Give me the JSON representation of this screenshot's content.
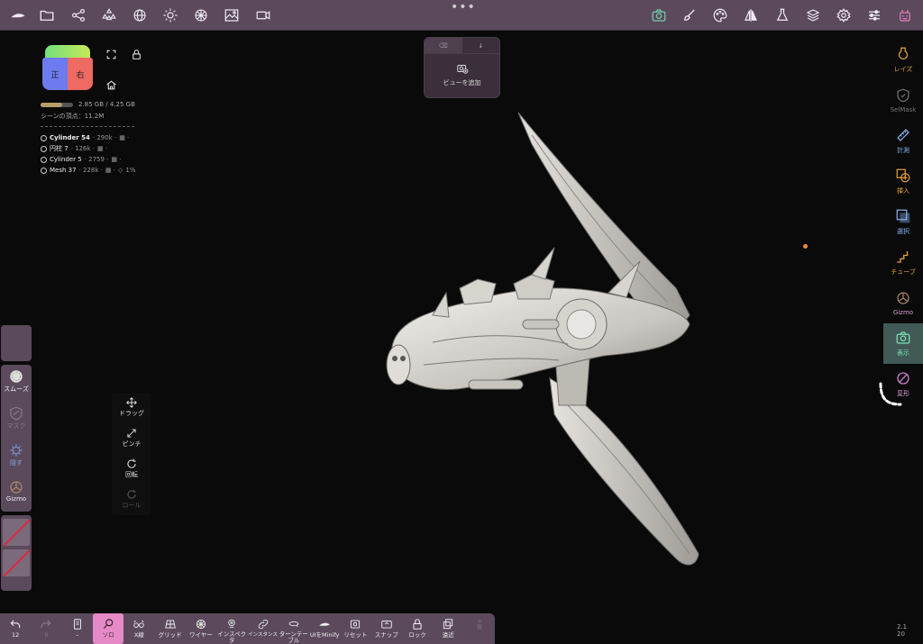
{
  "top_toolbar": {
    "left_icons": [
      "nomad-logo-icon",
      "folder-icon",
      "scene-graph-icon",
      "primitives-icon",
      "sphere-icon",
      "sun-icon",
      "material-icon",
      "image-icon",
      "video-camera-icon"
    ],
    "right_icons": [
      "camera-icon",
      "brush-icon",
      "palette-icon",
      "symmetry-icon",
      "flask-icon",
      "layers-icon",
      "settings-icon",
      "sliders-icon",
      "nomad-mascot-icon"
    ],
    "more": "•••"
  },
  "view_popover": {
    "tab_left": "⌫",
    "tab_right": "↓",
    "add_view_label": "ビューを追加"
  },
  "nav_cube": {
    "left_face": "正",
    "right_face": "右"
  },
  "memory": {
    "text": "2.85 GB / 4.25 GB",
    "fraction": 0.67
  },
  "scene_vertices": "シーンの頂点：11.2M",
  "objects": [
    {
      "name": "Cylinder 54",
      "count": "· 290k ·",
      "suffix": ""
    },
    {
      "name": "円柱 7",
      "count": "· 126k ·",
      "suffix": ""
    },
    {
      "name": "Cylinder 5",
      "count": "· 2759 ·",
      "suffix": ""
    },
    {
      "name": "Mesh 37",
      "count": "· 228k ·",
      "suffix": "1%"
    }
  ],
  "left_panel": {
    "tools": [
      {
        "label": "スムーズ",
        "icon": "smooth-icon"
      },
      {
        "label": "マスク",
        "icon": "mask-icon"
      },
      {
        "label": "隠す",
        "icon": "hide-icon"
      },
      {
        "label": "Gizmo",
        "icon": "gizmo-icon"
      }
    ]
  },
  "gestures": [
    {
      "label": "ドラッグ",
      "icon": "drag-icon"
    },
    {
      "label": "ピンチ",
      "icon": "pinch-icon"
    },
    {
      "label": "回転",
      "icon": "rotate-icon"
    },
    {
      "label": "ロール",
      "icon": "roll-icon"
    }
  ],
  "right_panel": [
    {
      "label": "レイズ",
      "icon": "clay-icon"
    },
    {
      "label": "SelMask",
      "icon": "selmask-icon"
    },
    {
      "label": "計測",
      "icon": "ruler-icon"
    },
    {
      "label": "挿入",
      "icon": "insert-icon"
    },
    {
      "label": "選択",
      "icon": "select-icon"
    },
    {
      "label": "チューブ",
      "icon": "tube-icon"
    },
    {
      "label": "Gizmo",
      "icon": "gizmo-icon"
    },
    {
      "label": "表示",
      "icon": "view-icon"
    },
    {
      "label": "変形",
      "icon": "transform-icon"
    }
  ],
  "bottom_toolbar": [
    {
      "label": "12",
      "icon": "undo-icon"
    },
    {
      "label": "0",
      "icon": "redo-icon"
    },
    {
      "label": "–",
      "icon": "history-icon"
    },
    {
      "label": "ソロ",
      "icon": "solo-icon"
    },
    {
      "label": "X線",
      "icon": "xray-icon"
    },
    {
      "label": "グリッド",
      "icon": "grid-icon"
    },
    {
      "label": "ワイヤー",
      "icon": "wireframe-icon"
    },
    {
      "label": "インスペクタ",
      "icon": "inspector-icon"
    },
    {
      "label": "インスタンス",
      "icon": "instance-icon"
    },
    {
      "label": "ターンテーブル",
      "icon": "turntable-icon"
    },
    {
      "label": "UIをMinify",
      "icon": "minify-icon"
    },
    {
      "label": "リセット",
      "icon": "reset-icon"
    },
    {
      "label": "スナップ",
      "icon": "snap-icon"
    },
    {
      "label": "ロック",
      "icon": "lock-icon"
    },
    {
      "label": "遠近",
      "icon": "perspective-icon"
    }
  ],
  "version": {
    "line1": "2.1",
    "line2": "20"
  }
}
